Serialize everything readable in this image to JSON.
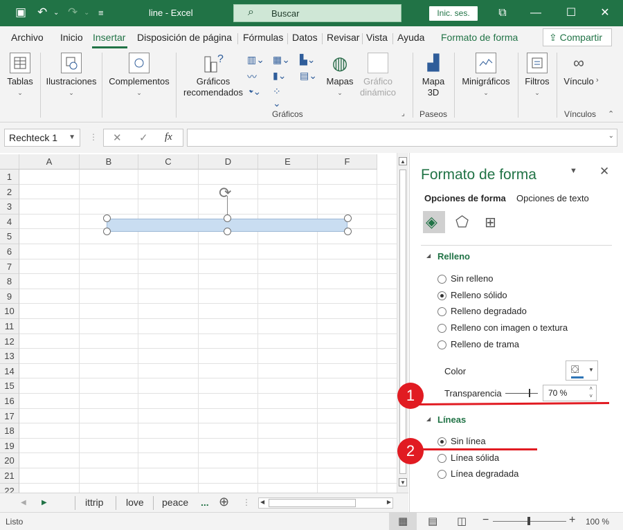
{
  "titlebar": {
    "title": "line  -  Excel",
    "search_label": "Buscar",
    "signin_label": "Inic. ses."
  },
  "tabs": [
    "Archivo",
    "Inicio",
    "Insertar",
    "Disposición de página",
    "Fórmulas",
    "Datos",
    "Revisar",
    "Vista",
    "Ayuda",
    "Formato de forma"
  ],
  "share_label": "Compartir",
  "ribbon": {
    "tablas": "Tablas",
    "ilustraciones": "Ilustraciones",
    "complementos": "Complementos",
    "graficos_rec_1": "Gráficos",
    "graficos_rec_2": "recomendados",
    "mapas": "Mapas",
    "grafico_din_1": "Gráfico",
    "grafico_din_2": "dinámico",
    "mapa3d_1": "Mapa",
    "mapa3d_2": "3D",
    "minigraficos": "Minigráficos",
    "filtros": "Filtros",
    "vinculos": "Víncul",
    "grp_graficos": "Gráficos",
    "grp_paseos": "Paseos",
    "grp_vinculos": "Vínculos"
  },
  "formula_bar": {
    "name_box": "Rechteck 1",
    "fx": "fx"
  },
  "columns": [
    "A",
    "B",
    "C",
    "D",
    "E",
    "F"
  ],
  "rows": [
    "1",
    "2",
    "3",
    "4",
    "5",
    "6",
    "7",
    "8",
    "9",
    "10",
    "11",
    "12",
    "13",
    "14",
    "15",
    "16",
    "17",
    "18",
    "19",
    "20",
    "21",
    "22"
  ],
  "sheet_tabs": [
    "ittrip",
    "love",
    "peace",
    "..."
  ],
  "status": {
    "ready": "Listo",
    "zoom": "100 %"
  },
  "pane": {
    "title": "Formato de forma",
    "tab_shape": "Opciones de forma",
    "tab_text": "Opciones de texto",
    "fill_section": "Relleno",
    "fill_options": [
      "Sin relleno",
      "Relleno sólido",
      "Relleno degradado",
      "Relleno con imagen o textura",
      "Relleno de trama"
    ],
    "fill_selected": 1,
    "color_label": "Color",
    "transparency_label": "Transparencia",
    "transparency_value": "70 %",
    "lines_section": "Líneas",
    "line_options": [
      "Sin línea",
      "Línea sólida",
      "Línea degradada"
    ],
    "line_selected": 0
  },
  "callouts": [
    "1",
    "2"
  ],
  "colors": {
    "excel_green": "#217346",
    "callout_red": "#e11b22",
    "shape_fill": "#c9ddf1"
  }
}
